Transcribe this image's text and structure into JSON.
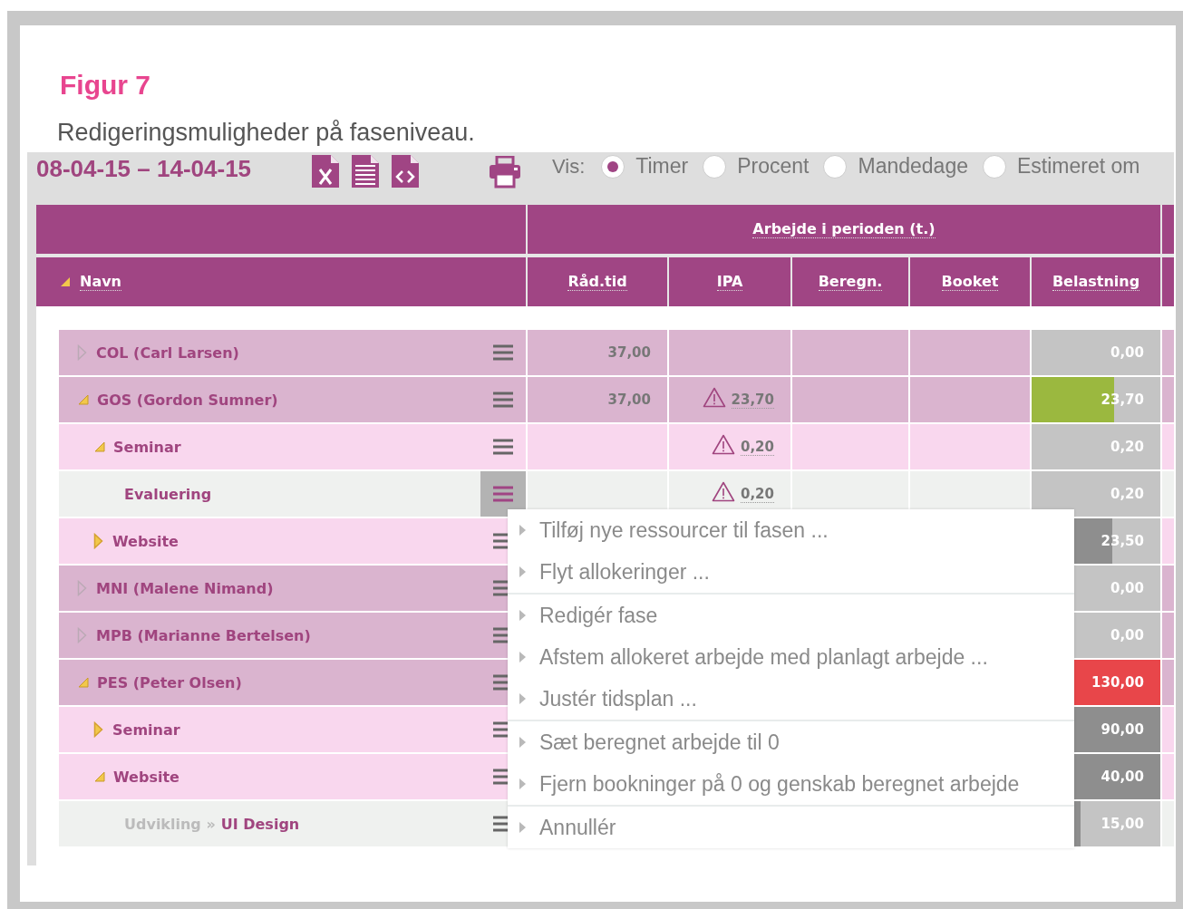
{
  "figure": {
    "label": "Figur 7",
    "caption": "Redigeringsmuligheder på faseniveau."
  },
  "toolbar": {
    "period": "08-04-15 – 14-04-15",
    "view_label": "Vis:",
    "view_options": [
      {
        "label": "Timer",
        "selected": true
      },
      {
        "label": "Procent",
        "selected": false
      },
      {
        "label": "Mandedage",
        "selected": false
      },
      {
        "label": "Estimeret om",
        "selected": false
      }
    ]
  },
  "table": {
    "group_header": "Arbejde i perioden (t.)",
    "name_column": "Navn",
    "columns": [
      "Råd.tid",
      "IPA",
      "Beregn.",
      "Booket",
      "Belastning"
    ],
    "rows": [
      {
        "kind": "person",
        "name": "COL (Carl Larsen)",
        "expanded": false,
        "menu_open": false,
        "rad_tid": "37,00",
        "load": {
          "value": "0,00"
        }
      },
      {
        "kind": "person",
        "name": "GOS (Gordon Sumner)",
        "expanded": true,
        "menu_open": false,
        "rad_tid": "37,00",
        "ipa": {
          "value": "23,70",
          "warning": true
        },
        "load": {
          "value": "23,70",
          "level": 0.64,
          "color": "#9bb83f"
        },
        "children": [
          {
            "kind": "phase",
            "name": "Seminar",
            "expanded": true,
            "menu_open": false,
            "ipa": {
              "value": "0,20",
              "warning": true
            },
            "load": {
              "value": "0,20"
            },
            "children": [
              {
                "kind": "task",
                "name": "Evaluering",
                "menu_open": true,
                "ipa": {
                  "value": "0,20",
                  "warning": true
                },
                "load": {
                  "value": "0,20"
                }
              }
            ]
          },
          {
            "kind": "phase",
            "name": "Website",
            "expanded": false,
            "menu_open": false,
            "load": {
              "value": "23,50",
              "level": 0.63,
              "color": "#8e8e8e"
            }
          }
        ]
      },
      {
        "kind": "person",
        "name": "MNI (Malene Nimand)",
        "expanded": false,
        "menu_open": false,
        "load": {
          "value": "0,00"
        }
      },
      {
        "kind": "person",
        "name": "MPB (Marianne Bertelsen)",
        "expanded": false,
        "menu_open": false,
        "load": {
          "value": "0,00"
        }
      },
      {
        "kind": "person",
        "name": "PES (Peter Olsen)",
        "expanded": true,
        "menu_open": false,
        "load": {
          "value": "130,00",
          "level": 1,
          "color": "#e8464a"
        },
        "children": [
          {
            "kind": "phase",
            "name": "Seminar",
            "expanded": false,
            "menu_open": false,
            "load": {
              "value": "90,00",
              "level": 1,
              "color": "#8e8e8e"
            }
          },
          {
            "kind": "phase",
            "name": "Website",
            "expanded": true,
            "menu_open": false,
            "load": {
              "value": "40,00",
              "level": 1,
              "color": "#8e8e8e"
            },
            "children": [
              {
                "kind": "task",
                "path": "Udvikling »",
                "name": "UI Design",
                "menu_open": false,
                "load": {
                  "value": "15,00",
                  "level": 0.38,
                  "color": "#8e8e8e"
                }
              }
            ]
          }
        ]
      }
    ]
  },
  "context_menu": {
    "groups": [
      [
        "Tilføj nye ressourcer til fasen ...",
        "Flyt allokeringer ..."
      ],
      [
        "Redigér fase",
        "Afstem allokeret arbejde med planlagt arbejde ...",
        "Justér tidsplan ..."
      ],
      [
        "Sæt beregnet arbejde til 0",
        "Fjern bookninger på 0 og genskab beregnet arbejde"
      ],
      [
        "Annullér"
      ]
    ]
  }
}
